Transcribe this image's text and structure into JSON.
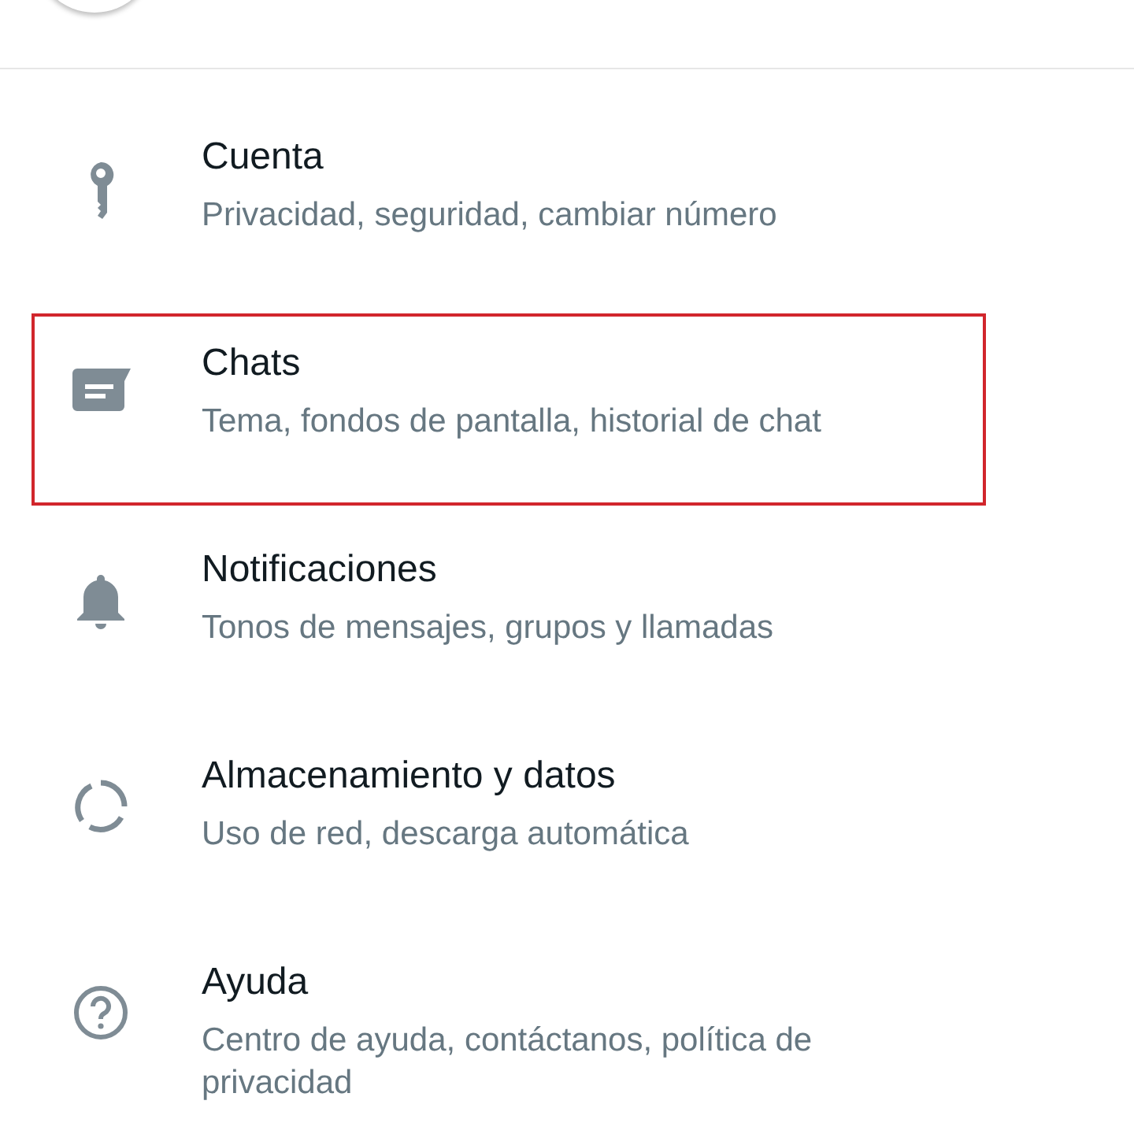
{
  "settings": [
    {
      "kind": "key",
      "title": "Cuenta",
      "subtitle": "Privacidad, seguridad, cambiar número",
      "highlighted": false
    },
    {
      "kind": "chat",
      "title": "Chats",
      "subtitle": "Tema, fondos de pantalla, historial de chat",
      "highlighted": true
    },
    {
      "kind": "bell",
      "title": "Notificaciones",
      "subtitle": "Tonos de mensajes, grupos y llamadas",
      "highlighted": false
    },
    {
      "kind": "storage",
      "title": "Almacenamiento y datos",
      "subtitle": "Uso de red, descarga automática",
      "highlighted": false
    },
    {
      "kind": "help",
      "title": "Ayuda",
      "subtitle": "Centro de ayuda, contáctanos, política de privacidad",
      "highlighted": false
    }
  ]
}
